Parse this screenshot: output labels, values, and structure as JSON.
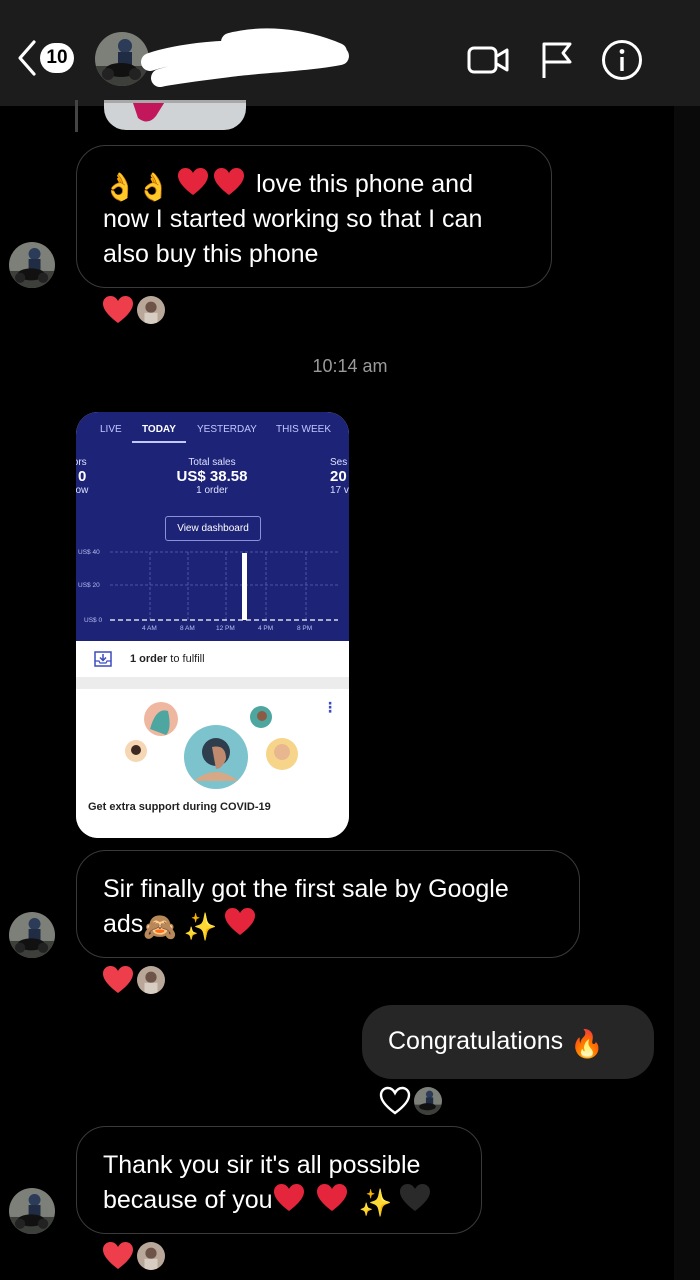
{
  "header": {
    "unread_count": "10",
    "icons": [
      "back-arrow-icon",
      "video-call-icon",
      "flag-icon",
      "info-icon"
    ]
  },
  "messages": {
    "m1": "love this phone and now I started working so that I can also  buy this phone",
    "time": "10:14 am",
    "m2_text": "Sir finally got the first sale by Google ads",
    "reply": "Congratulations",
    "m3_text": "Thank you sir it's all possible because of you"
  },
  "screenshot": {
    "tabs": [
      "LIVE",
      "TODAY",
      "YESTERDAY",
      "THIS WEEK"
    ],
    "left_stat": {
      "label": "tors",
      "value": "0",
      "sub": "now"
    },
    "total_sales": {
      "label": "Total sales",
      "value": "US$ 38.58",
      "sub": "1 order"
    },
    "right_stat": {
      "label": "Ses",
      "value": "20",
      "sub": "17 v"
    },
    "view_dashboard": "View dashboard",
    "y_ticks": [
      "US$ 40",
      "US$ 20",
      "US$ 0"
    ],
    "x_ticks": [
      "4 AM",
      "8 AM",
      "12 PM",
      "4 PM",
      "8 PM"
    ],
    "fulfill_bold": "1 order",
    "fulfill_rest": "to fulfill",
    "card_title": "Get extra support during COVID-19"
  },
  "colors": {
    "background": "#000000",
    "header": "#1c1c1c",
    "bubble_border": "#3a3a3a",
    "my_bubble": "#262626",
    "heart": "#ee3e4b",
    "shopify_blue": "#1d2478"
  }
}
